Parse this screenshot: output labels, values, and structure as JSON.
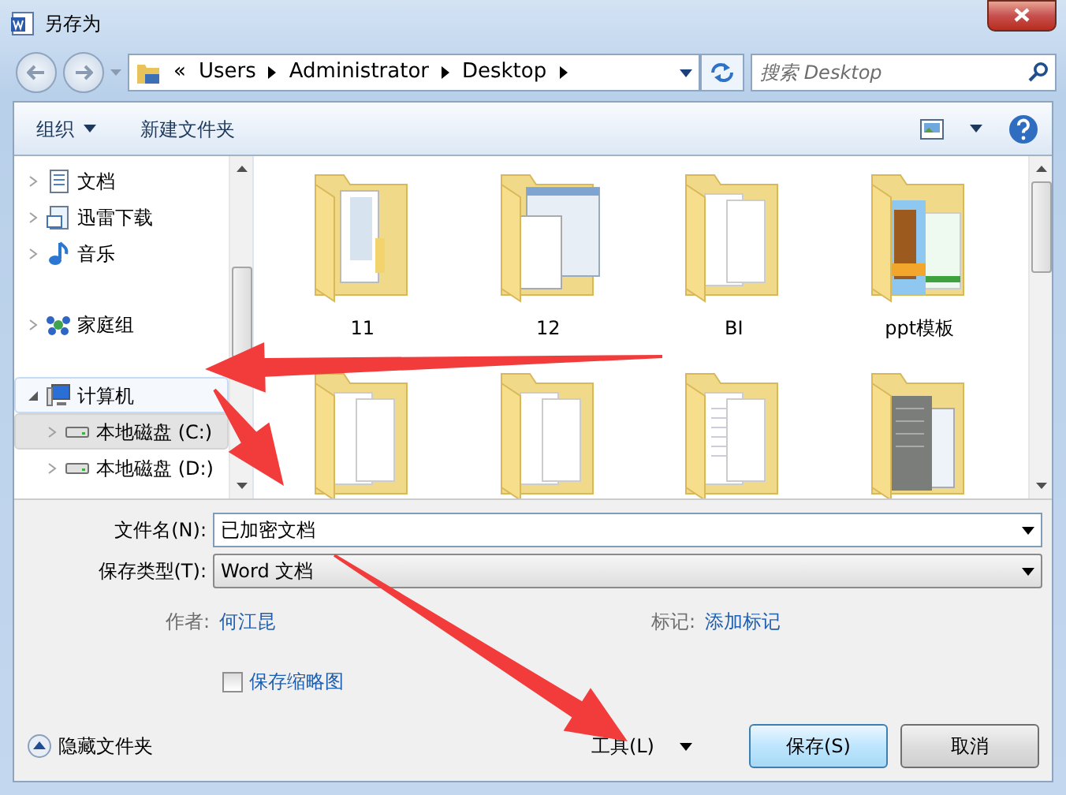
{
  "window": {
    "title": "另存为"
  },
  "address": {
    "lead": "«",
    "crumbs": [
      "Users",
      "Administrator",
      "Desktop"
    ]
  },
  "search": {
    "placeholder": "搜索 Desktop"
  },
  "toolbar": {
    "organize": "组织",
    "new_folder": "新建文件夹"
  },
  "nav_groups": [
    [
      {
        "label": "文档",
        "kind": "docs",
        "expanded": false,
        "selected": false,
        "focused": false
      },
      {
        "label": "迅雷下载",
        "kind": "download",
        "expanded": false,
        "selected": false,
        "focused": false
      },
      {
        "label": "音乐",
        "kind": "music",
        "expanded": false,
        "selected": false,
        "focused": false
      }
    ],
    [
      {
        "label": "家庭组",
        "kind": "homegroup",
        "expanded": false,
        "selected": false,
        "focused": false
      }
    ],
    [
      {
        "label": "计算机",
        "kind": "computer",
        "expanded": true,
        "selected": false,
        "focused": true,
        "children": [
          {
            "label": "本地磁盘 (C:)",
            "kind": "drive",
            "expanded": false,
            "selected": true,
            "focused": false
          },
          {
            "label": "本地磁盘 (D:)",
            "kind": "drive",
            "expanded": false,
            "selected": false,
            "focused": false
          }
        ]
      }
    ]
  ],
  "files": [
    {
      "label": "11",
      "kind": "docs"
    },
    {
      "label": "12",
      "kind": "window"
    },
    {
      "label": "BI",
      "kind": "blank"
    },
    {
      "label": "ppt模板",
      "kind": "picture"
    },
    {
      "kind": "blank"
    },
    {
      "kind": "blank"
    },
    {
      "kind": "lined"
    },
    {
      "kind": "scan"
    }
  ],
  "form": {
    "filename_label": "文件名(N):",
    "filename": "已加密文档",
    "type_label": "保存类型(T):",
    "type": "Word 文档",
    "author_label": "作者:",
    "author": "何江昆",
    "tags_label": "标记:",
    "tags": "添加标记",
    "thumbnail": {
      "label": "保存缩略图",
      "checked": false
    }
  },
  "footer": {
    "hide_folders": "隐藏文件夹",
    "tools": "工具(L)",
    "save": "保存(S)",
    "cancel": "取消"
  }
}
